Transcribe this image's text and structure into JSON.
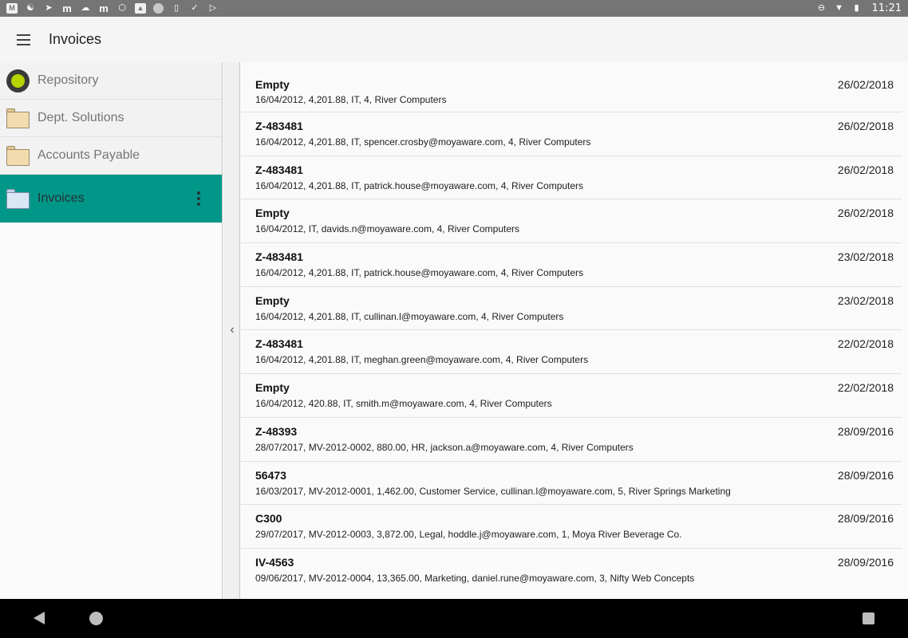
{
  "status_bar": {
    "left_icons": [
      "gmail-icon",
      "share-icon",
      "arrow-icon",
      "m-icon",
      "cloud-icon",
      "m-icon",
      "hexagon-icon",
      "image-icon",
      "circle-icon",
      "phone-icon",
      "check-icon",
      "play-icon"
    ],
    "time": "11:21"
  },
  "app_bar": {
    "title": "Invoices"
  },
  "sidebar": {
    "items": [
      {
        "label": "Repository",
        "icon": "repository-icon"
      },
      {
        "label": "Dept. Solutions",
        "icon": "folder-icon"
      },
      {
        "label": "Accounts Payable",
        "icon": "folder-icon"
      },
      {
        "label": "Invoices",
        "icon": "folder-icon",
        "active": true
      }
    ]
  },
  "colors": {
    "accent": "#009688",
    "statusbar": "#757575"
  },
  "invoices": [
    {
      "title": "Empty",
      "date": "26/02/2018",
      "detail": "16/04/2012, 4,201.88, IT, 4, River Computers"
    },
    {
      "title": "Z-483481",
      "date": "26/02/2018",
      "detail": "16/04/2012, 4,201.88, IT, spencer.crosby@moyaware.com, 4, River Computers"
    },
    {
      "title": "Z-483481",
      "date": "26/02/2018",
      "detail": "16/04/2012, 4,201.88, IT, patrick.house@moyaware.com, 4, River Computers"
    },
    {
      "title": "Empty",
      "date": "26/02/2018",
      "detail": "16/04/2012, IT, davids.n@moyaware.com, 4, River Computers"
    },
    {
      "title": "Z-483481",
      "date": "23/02/2018",
      "detail": "16/04/2012, 4,201.88, IT, patrick.house@moyaware.com, 4, River Computers"
    },
    {
      "title": "Empty",
      "date": "23/02/2018",
      "detail": "16/04/2012, 4,201.88, IT, cullinan.l@moyaware.com, 4, River Computers"
    },
    {
      "title": "Z-483481",
      "date": "22/02/2018",
      "detail": "16/04/2012, 4,201.88, IT, meghan.green@moyaware.com, 4, River Computers"
    },
    {
      "title": "Empty",
      "date": "22/02/2018",
      "detail": "16/04/2012, 420.88, IT, smith.m@moyaware.com, 4, River Computers"
    },
    {
      "title": "Z-48393",
      "date": "28/09/2016",
      "detail": "28/07/2017, MV-2012-0002, 880.00, HR, jackson.a@moyaware.com, 4, River Computers"
    },
    {
      "title": "56473",
      "date": "28/09/2016",
      "detail": "16/03/2017, MV-2012-0001, 1,462.00, Customer Service, cullinan.l@moyaware.com, 5, River Springs Marketing"
    },
    {
      "title": "C300",
      "date": "28/09/2016",
      "detail": "29/07/2017, MV-2012-0003, 3,872.00, Legal, hoddle.j@moyaware.com, 1, Moya River Beverage Co."
    },
    {
      "title": "IV-4563",
      "date": "28/09/2016",
      "detail": "09/06/2017, MV-2012-0004, 13,365.00, Marketing, daniel.rune@moyaware.com, 3, Nifty Web Concepts"
    }
  ]
}
